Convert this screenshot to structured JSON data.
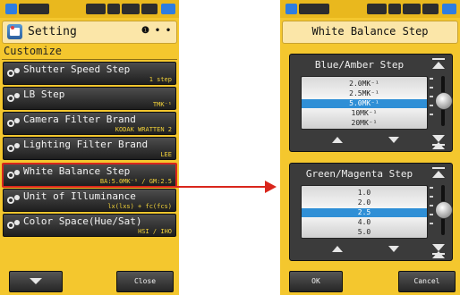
{
  "left": {
    "title": "Setting",
    "pager": "❶ • •",
    "section": "Customize",
    "items": [
      {
        "label": "Shutter Speed Step",
        "value": "1 step"
      },
      {
        "label": "LB Step",
        "value": "TMK⁻¹"
      },
      {
        "label": "Camera Filter Brand",
        "value": "KODAK WRATTEN 2"
      },
      {
        "label": "Lighting Filter Brand",
        "value": "LEE"
      },
      {
        "label": "White Balance Step",
        "value": "BA:5.0MK⁻¹ / GM:2.5"
      },
      {
        "label": "Unit of Illuminance",
        "value": "lx(lxs) + fc(fcs)"
      },
      {
        "label": "Color Space(Hue/Sat)",
        "value": "HSI / IHO"
      }
    ],
    "close_label": "Close"
  },
  "right": {
    "title": "White Balance Step",
    "blue_amber": {
      "title": "Blue/Amber Step",
      "options": [
        "2.0MK⁻¹",
        "2.5MK⁻¹",
        "5.0MK⁻¹",
        "10MK⁻¹",
        "20MK⁻¹"
      ],
      "selected_index": 2
    },
    "green_magenta": {
      "title": "Green/Magenta Step",
      "options": [
        "1.0",
        "2.0",
        "2.5",
        "4.0",
        "5.0"
      ],
      "selected_index": 2
    },
    "ok_label": "OK",
    "cancel_label": "Cancel"
  },
  "colors": {
    "screen_bg": "#f4c72e",
    "selection_border": "#d9261c",
    "picker_highlight": "#2f8fd6"
  }
}
